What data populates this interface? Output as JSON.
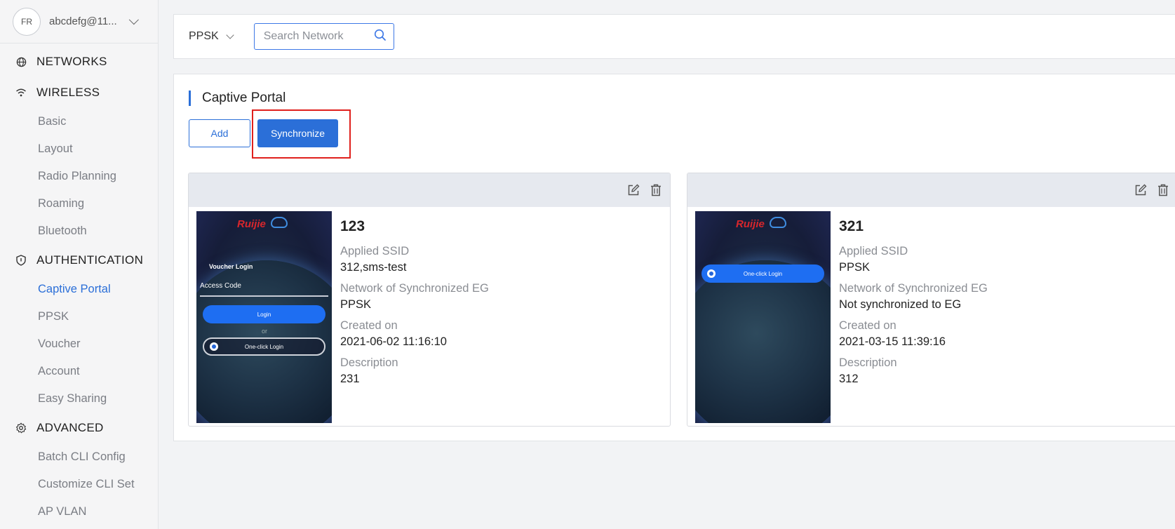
{
  "user": {
    "name": "abcdefg@11...",
    "avatar_text": "FR"
  },
  "sidebar": {
    "networks": {
      "label": "NETWORKS",
      "icon": "globe-icon"
    },
    "wireless": {
      "label": "WIRELESS",
      "icon": "wifi-icon",
      "items": [
        "Basic",
        "Layout",
        "Radio Planning",
        "Roaming",
        "Bluetooth"
      ]
    },
    "authentication": {
      "label": "AUTHENTICATION",
      "icon": "shield-icon",
      "items": [
        "Captive Portal",
        "PPSK",
        "Voucher",
        "Account",
        "Easy Sharing"
      ],
      "active": "Captive Portal"
    },
    "advanced": {
      "label": "ADVANCED",
      "icon": "gear-icon",
      "items": [
        "Batch CLI Config",
        "Customize CLI Set",
        "AP VLAN"
      ]
    }
  },
  "topbar": {
    "network_select": "PPSK",
    "search_placeholder": "Search Network"
  },
  "main": {
    "title": "Captive Portal",
    "add_label": "Add",
    "sync_label": "Synchronize"
  },
  "cards": [
    {
      "name": "123",
      "applied_ssid_label": "Applied SSID",
      "applied_ssid": "312,sms-test",
      "network_label": "Network of Synchronized EG",
      "network": "PPSK",
      "created_label": "Created on",
      "created": "2021-06-02 11:16:10",
      "description_label": "Description",
      "description": "231",
      "preview": {
        "brand": "Ruijie",
        "voucher_login": "Voucher Login",
        "access_code": "Access Code",
        "login": "Login",
        "or": "or",
        "one_click": "One-click Login"
      }
    },
    {
      "name": "321",
      "applied_ssid_label": "Applied SSID",
      "applied_ssid": "PPSK",
      "network_label": "Network of Synchronized EG",
      "network": "Not synchronized to EG",
      "created_label": "Created on",
      "created": "2021-03-15 11:39:16",
      "description_label": "Description",
      "description": "312",
      "preview": {
        "brand": "Ruijie",
        "one_click": "One-click Login"
      }
    }
  ],
  "colors": {
    "accent": "#2b6fd8",
    "highlight": "#e0201c"
  }
}
